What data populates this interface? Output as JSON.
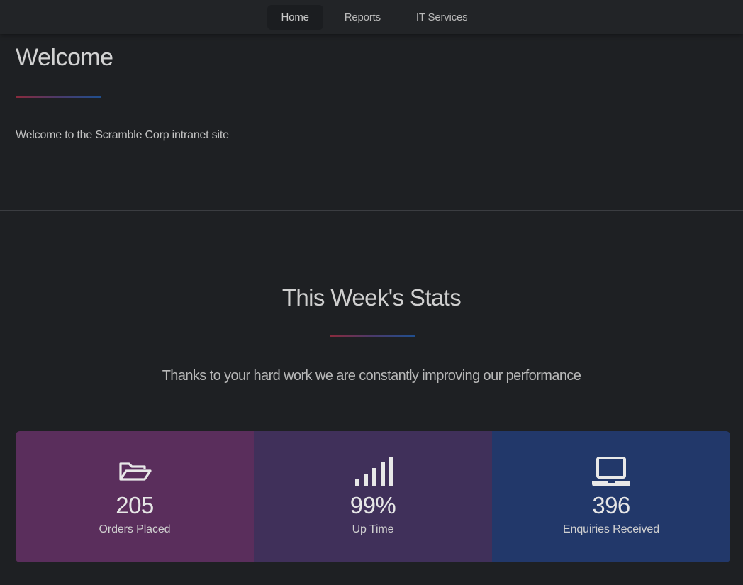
{
  "nav": {
    "items": [
      {
        "label": "Home",
        "active": true
      },
      {
        "label": "Reports",
        "active": false
      },
      {
        "label": "IT Services",
        "active": false
      }
    ]
  },
  "welcome": {
    "title": "Welcome",
    "text": "Welcome to the Scramble Corp intranet site"
  },
  "stats": {
    "title": "This Week's Stats",
    "subtitle": "Thanks to your hard work we are constantly improving our performance",
    "cards": [
      {
        "icon": "folder-open-icon",
        "value": "205",
        "label": "Orders Placed",
        "color": "#5a2e5c"
      },
      {
        "icon": "signal-bars-icon",
        "value": "99%",
        "label": "Up Time",
        "color": "#40305a"
      },
      {
        "icon": "laptop-icon",
        "value": "396",
        "label": "Enquiries Received",
        "color": "#22386a"
      }
    ]
  }
}
